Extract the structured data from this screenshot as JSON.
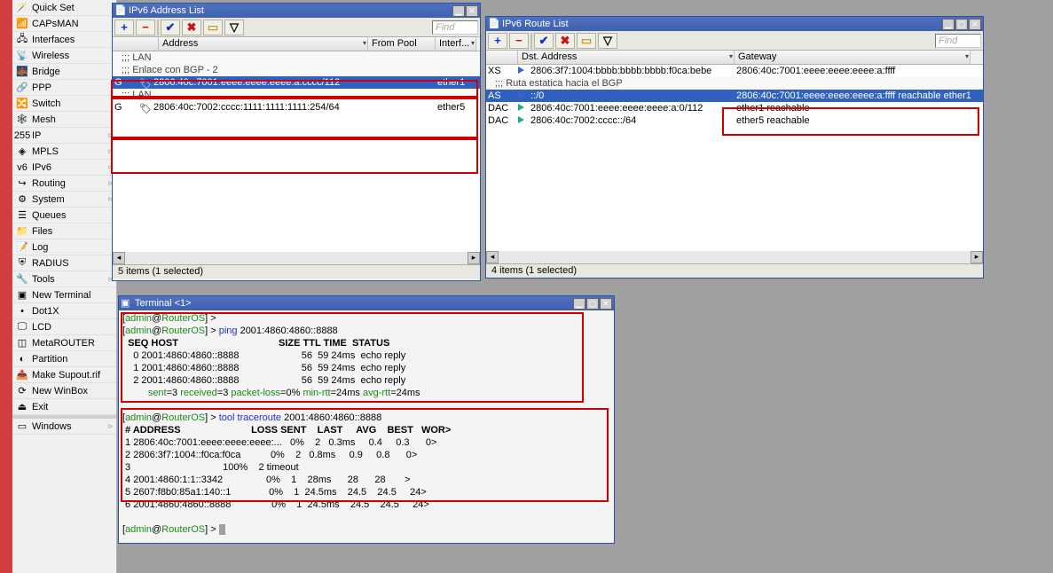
{
  "sidebar": {
    "items": [
      {
        "icon": "wand",
        "label": "Quick Set",
        "arrow": false
      },
      {
        "icon": "caps",
        "label": "CAPsMAN",
        "arrow": false
      },
      {
        "icon": "iface",
        "label": "Interfaces",
        "arrow": false
      },
      {
        "icon": "wifi",
        "label": "Wireless",
        "arrow": false
      },
      {
        "icon": "bridge",
        "label": "Bridge",
        "arrow": false
      },
      {
        "icon": "ppp",
        "label": "PPP",
        "arrow": false
      },
      {
        "icon": "switch",
        "label": "Switch",
        "arrow": false
      },
      {
        "icon": "mesh",
        "label": "Mesh",
        "arrow": false
      },
      {
        "icon": "ip",
        "label": "IP",
        "arrow": true
      },
      {
        "icon": "mpls",
        "label": "MPLS",
        "arrow": true
      },
      {
        "icon": "ipv6",
        "label": "IPv6",
        "arrow": true
      },
      {
        "icon": "routing",
        "label": "Routing",
        "arrow": true
      },
      {
        "icon": "system",
        "label": "System",
        "arrow": true
      },
      {
        "icon": "queues",
        "label": "Queues",
        "arrow": false
      },
      {
        "icon": "files",
        "label": "Files",
        "arrow": false
      },
      {
        "icon": "log",
        "label": "Log",
        "arrow": false
      },
      {
        "icon": "radius",
        "label": "RADIUS",
        "arrow": false
      },
      {
        "icon": "tools",
        "label": "Tools",
        "arrow": true
      },
      {
        "icon": "term",
        "label": "New Terminal",
        "arrow": false
      },
      {
        "icon": "dot1x",
        "label": "Dot1X",
        "arrow": false
      },
      {
        "icon": "lcd",
        "label": "LCD",
        "arrow": false
      },
      {
        "icon": "meta",
        "label": "MetaROUTER",
        "arrow": false
      },
      {
        "icon": "part",
        "label": "Partition",
        "arrow": false
      },
      {
        "icon": "supout",
        "label": "Make Supout.rif",
        "arrow": false
      },
      {
        "icon": "winbox",
        "label": "New WinBox",
        "arrow": false
      },
      {
        "icon": "exit",
        "label": "Exit",
        "arrow": false
      }
    ],
    "windows": {
      "label": "Windows",
      "arrow": true
    }
  },
  "addr": {
    "title": "IPv6 Address List",
    "find": "Find",
    "cols": {
      "address": "Address",
      "fromPool": "From Pool",
      "interface": "Interf..."
    },
    "rows": [
      {
        "flag": "",
        "comment": ";;; LAN",
        "addr": "",
        "pool": "",
        "iface": ""
      },
      {
        "flag": "",
        "comment": ";;; Enlace con BGP - 2",
        "addr": "",
        "pool": "",
        "iface": ""
      },
      {
        "flag": "G",
        "comment": "",
        "addr": "2806:40c:7001:eeee:eeee:eeee:a:cccc/112",
        "pool": "",
        "iface": "ether1",
        "sel": true
      },
      {
        "flag": "",
        "comment": ";;; LAN",
        "addr": "",
        "pool": "",
        "iface": ""
      },
      {
        "flag": "G",
        "comment": "",
        "addr": "2806:40c:7002:cccc:1111:1111:1111:254/64",
        "pool": "",
        "iface": "ether5"
      }
    ],
    "status": "5 items (1 selected)"
  },
  "route": {
    "title": "IPv6 Route List",
    "find": "Find",
    "cols": {
      "dst": "Dst. Address",
      "gw": "Gateway"
    },
    "rows": [
      {
        "flag": "XS",
        "dst": "2806:3f7:1004:bbbb:bbbb:bbbb:f0ca:bebe",
        "gw": "2806:40c:7001:eeee:eeee:eeee:a:ffff",
        "kind": "blue"
      },
      {
        "flag": "",
        "comment": ";;; Ruta estatica hacia el BGP"
      },
      {
        "flag": "AS",
        "dst": "::/0",
        "gw": "2806:40c:7001:eeee:eeee:eeee:a:ffff reachable ether1",
        "kind": "blue",
        "sel": true
      },
      {
        "flag": "DAC",
        "dst": "2806:40c:7001:eeee:eeee:eeee:a:0/112",
        "gw": "ether1 reachable",
        "kind": "green"
      },
      {
        "flag": "DAC",
        "dst": "2806:40c:7002:cccc::/64",
        "gw": "ether5 reachable",
        "kind": "green"
      }
    ],
    "status": "4 items (1 selected)"
  },
  "terminal": {
    "title": "Terminal <1>",
    "ping_cmd": "ping 2001:4860:4860::8888",
    "ping_header": "  SEQ HOST                                     SIZE TTL TIME  STATUS",
    "ping_rows": [
      "    0 2001:4860:4860::8888                       56  59 24ms  echo reply",
      "    1 2001:4860:4860::8888                       56  59 24ms  echo reply",
      "    2 2001:4860:4860::8888                       56  59 24ms  echo reply"
    ],
    "ping_sent_lbl": "sent",
    "ping_sent": "=3 ",
    "ping_recv_lbl": "received",
    "ping_recv": "=3 ",
    "ping_loss_lbl": "packet-loss",
    "ping_loss": "=0% ",
    "ping_min_lbl": "min-rtt",
    "ping_min": "=24ms ",
    "ping_avg_lbl": "avg-rtt",
    "ping_avg": "=24ms",
    "trace_cmd": "tool traceroute 2001:4860:4860::8888",
    "trace_prompt": "[admin@RouterOS] > ",
    "tr_header": " # ADDRESS                          LOSS SENT    LAST     AVG    BEST   WOR>",
    "tr_rows": [
      " 1 2806:40c:7001:eeee:eeee:eeee:...   0%    2   0.3ms     0.4     0.3      0>",
      " 2 2806:3f7:1004::f0ca:f0ca           0%    2   0.8ms     0.9     0.8      0>",
      " 3                                  100%    2 timeout",
      " 4 2001:4860:1:1::3342                0%    1    28ms      28      28       >",
      " 5 2607:f8b0:85a1:140::1              0%    1  24.5ms    24.5    24.5     24>",
      " 6 2001:4860:4860::8888               0%    1  24.5ms    24.5    24.5     24>"
    ]
  },
  "toolbar": {
    "add": "+",
    "remove": "−",
    "enable": "✔",
    "disable": "✖",
    "comment": "▭",
    "filter": "▽"
  }
}
